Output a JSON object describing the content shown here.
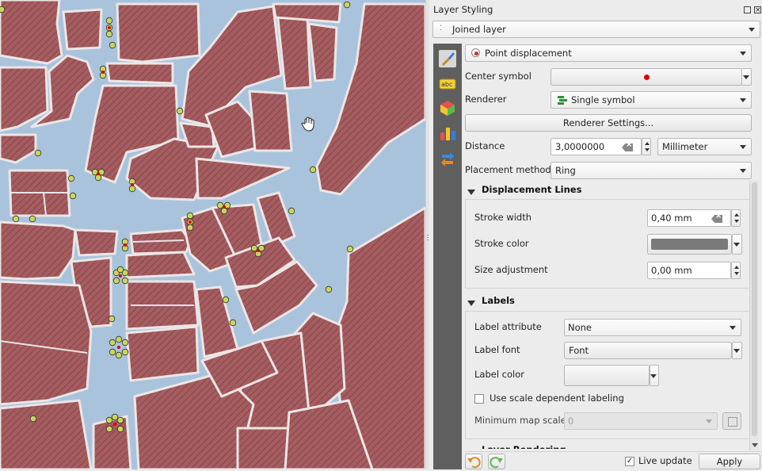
{
  "panel": {
    "title": "Layer Styling",
    "layer": "Joined layer",
    "renderer_type": "Point displacement",
    "center_symbol_label": "Center symbol",
    "renderer_label": "Renderer",
    "renderer_value": "Single symbol",
    "renderer_settings_button": "Renderer Settings...",
    "distance_label": "Distance",
    "distance_value": "3,0000000",
    "distance_unit": "Millimeter",
    "placement_label": "Placement method",
    "placement_value": "Ring",
    "displacement_lines": {
      "title": "Displacement Lines",
      "stroke_width_label": "Stroke width",
      "stroke_width_value": "0,40 mm",
      "stroke_color_label": "Stroke color",
      "stroke_color": "#7a7a7a",
      "size_adjustment_label": "Size adjustment",
      "size_adjustment_value": "0,00 mm"
    },
    "labels": {
      "title": "Labels",
      "label_attribute_label": "Label attribute",
      "label_attribute_value": "None",
      "label_font_label": "Label font",
      "label_font_value": "Font",
      "label_color_label": "Label color",
      "scale_dependent_label": "Use scale dependent labeling",
      "min_map_scale_label": "Minimum map scale",
      "min_map_scale_value": "0"
    },
    "layer_rendering_title": "Layer Rendering",
    "live_update_label": "Live update",
    "apply_button": "Apply"
  },
  "icons": [
    "paintbrush-icon",
    "labels-icon",
    "3d-view-icon",
    "diagram-icon",
    "history-icon",
    "undo-icon",
    "redo-icon",
    "hand-pan-icon"
  ],
  "colors": {
    "polygon_fill": "#a15b5e",
    "polygon_outline": "#e9e4e4",
    "water": "#a9c3dc",
    "point_fill": "#c9d65a",
    "center_point": "#e00000"
  }
}
